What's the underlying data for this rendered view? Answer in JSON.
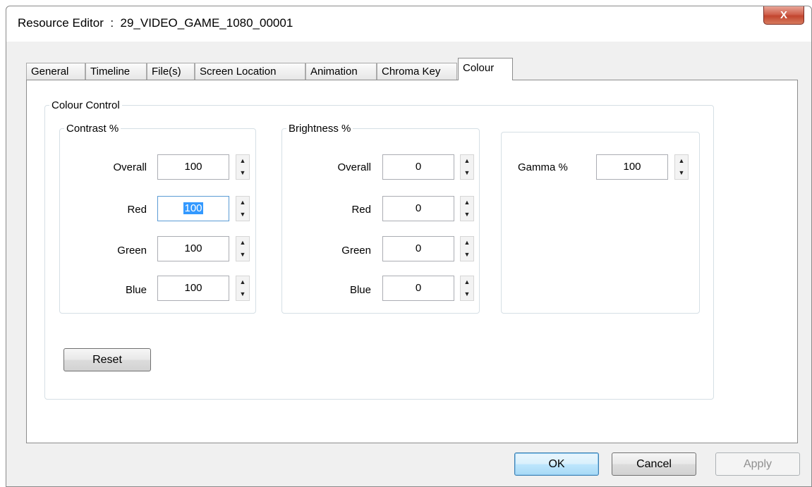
{
  "window": {
    "title": "Resource Editor  :  29_VIDEO_GAME_1080_00001",
    "close_label": "X"
  },
  "tabs": [
    "General",
    "Timeline",
    "File(s)",
    "Screen Location",
    "Animation",
    "Chroma Key",
    "Colour"
  ],
  "active_tab": "Colour",
  "colour_control": {
    "title": "Colour Control",
    "contrast": {
      "title": "Contrast %",
      "overall_label": "Overall",
      "overall": "100",
      "red_label": "Red",
      "red": "100",
      "green_label": "Green",
      "green": "100",
      "blue_label": "Blue",
      "blue": "100"
    },
    "brightness": {
      "title": "Brightness %",
      "overall_label": "Overall",
      "overall": "0",
      "red_label": "Red",
      "red": "0",
      "green_label": "Green",
      "green": "0",
      "blue_label": "Blue",
      "blue": "0"
    },
    "gamma": {
      "label": "Gamma %",
      "value": "100"
    },
    "reset_label": "Reset"
  },
  "buttons": {
    "ok": "OK",
    "cancel": "Cancel",
    "apply": "Apply"
  },
  "icons": {
    "spin_up": "spin-up-arrow-icon",
    "spin_down": "spin-down-arrow-icon"
  }
}
